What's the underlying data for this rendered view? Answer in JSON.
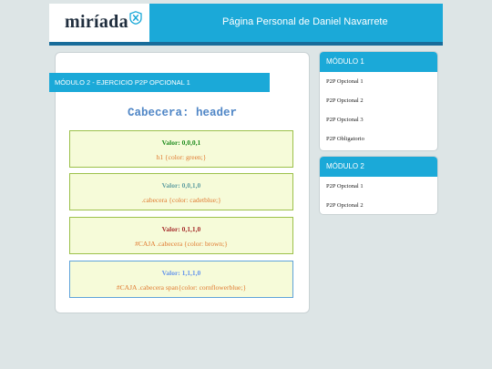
{
  "header": {
    "logo_text": "miríada",
    "title": "Página Personal de Daniel Navarrete"
  },
  "main": {
    "module_label": "MÓDULO 2 - EJERCICIO P2P OPCIONAL 1",
    "heading": "Cabecera: header",
    "rules": [
      {
        "value": "Valor: 0,0,0,1",
        "css": "h1 {color: green;}"
      },
      {
        "value": "Valor: 0,0,1,0",
        "css": ".cabecera {color: cadetblue;}"
      },
      {
        "value": "Valor: 0,1,1,0",
        "css": "#CAJA .cabecera {color: brown;}"
      },
      {
        "value": "Valor: 1,1,1,0",
        "css": "#CAJA .cabecera span{color: cornflowerblue;}"
      }
    ]
  },
  "sidebar": {
    "modules": [
      {
        "title": "MÓDULO 1",
        "items": [
          "P2P Opcional 1",
          "P2P Opcional 2",
          "P2P Opcional 3",
          "P2P Obligatorio"
        ]
      },
      {
        "title": "MÓDULO 2",
        "items": [
          "P2P Opcional 1",
          "P2P Opcional 2"
        ]
      }
    ]
  },
  "colors": {
    "accent": "#1ba9d8",
    "accent_dark": "#186c9a",
    "background": "#dde5e6",
    "rule_box_fill": "#f6fbd9",
    "rule_box_border": "#9cc14a",
    "rule_css_text": "#e0792f"
  },
  "icons": {
    "logo_mark": "shield-x-icon"
  }
}
